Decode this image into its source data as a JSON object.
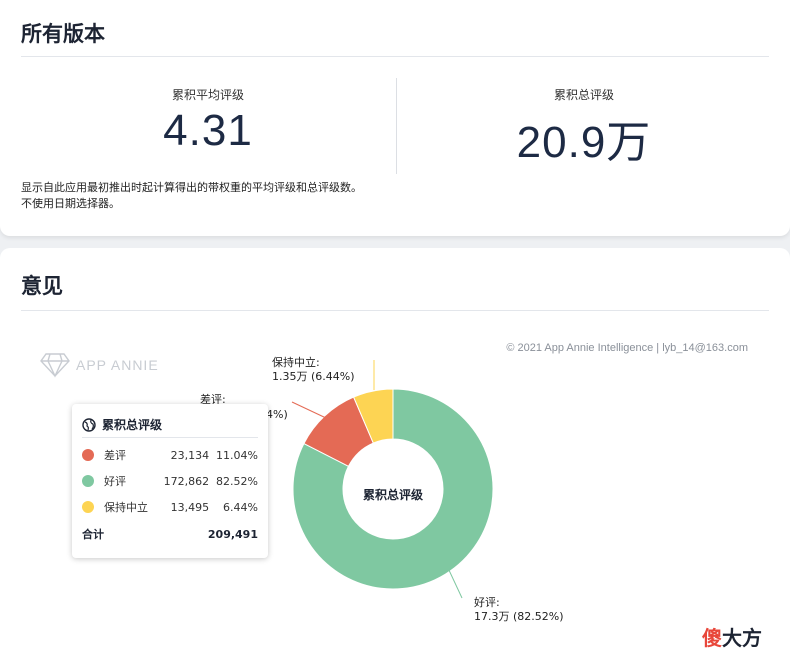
{
  "versions": {
    "title": "所有版本",
    "avg_label": "累积平均评级",
    "avg_value": "4.31",
    "total_label": "累积总评级",
    "total_value": "20.9万",
    "note_line1": "显示自此应用最初推出时起计算得出的带权重的平均评级和总评级数。",
    "note_line2": "不使用日期选择器。"
  },
  "opinion": {
    "title": "意见",
    "watermark": "APP ANNIE",
    "copyright": "© 2021 App Annie Intelligence | lyb_14@163.com",
    "center_label": "累积总评级",
    "callouts": {
      "neutral_name": "保持中立:",
      "neutral_value": "1.35万 (6.44%)",
      "negative_name": "差评:",
      "negative_partial": "4%)",
      "positive_name": "好评:",
      "positive_value": "17.3万 (82.52%)"
    },
    "tooltip": {
      "title": "累积总评级",
      "rows": [
        {
          "name": "差评",
          "count": "23,134",
          "pct": "11.04%",
          "color": "#e46a55"
        },
        {
          "name": "好评",
          "count": "172,862",
          "pct": "82.52%",
          "color": "#7fc8a1"
        },
        {
          "name": "保持中立",
          "count": "13,495",
          "pct": "6.44%",
          "color": "#fdd453"
        }
      ],
      "total_label": "合计",
      "total_value": "209,491"
    }
  },
  "chart_data": {
    "type": "pie",
    "title": "累积总评级",
    "slices": [
      {
        "name": "好评",
        "value": 172862,
        "percent": 82.52,
        "color": "#7fc8a1"
      },
      {
        "name": "差评",
        "value": 23134,
        "percent": 11.04,
        "color": "#e46a55"
      },
      {
        "name": "保持中立",
        "value": 13495,
        "percent": 6.44,
        "color": "#fdd453"
      }
    ]
  },
  "brand": {
    "part1": "傻",
    "part2": "大方"
  }
}
